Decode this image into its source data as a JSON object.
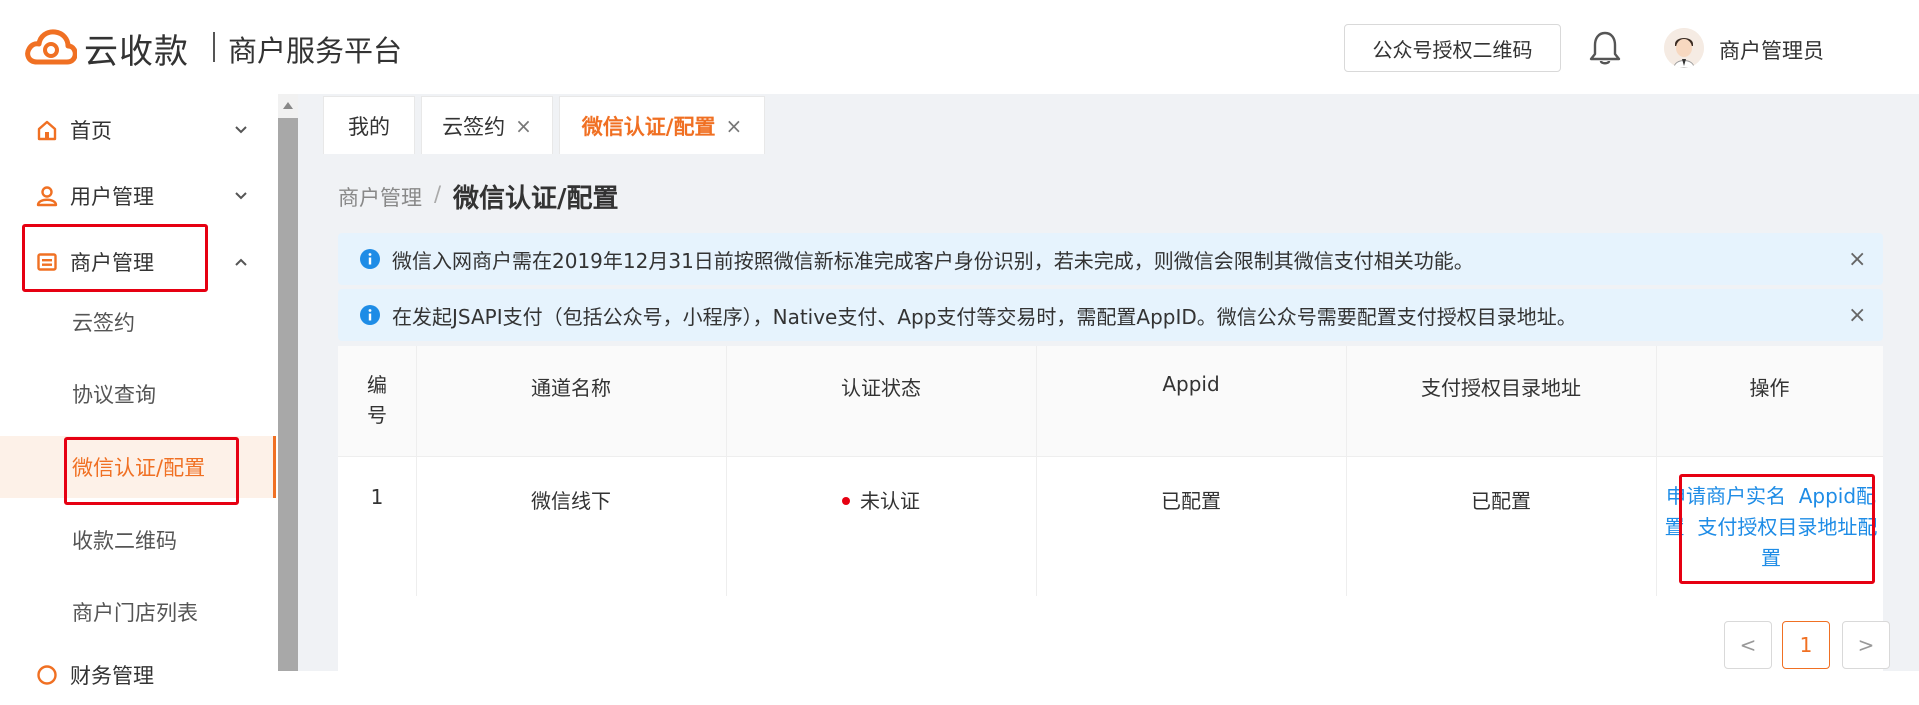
{
  "header": {
    "logo_text": "云收款",
    "platform_name": "商户服务平台",
    "qr_button_label": "公众号授权二维码",
    "username": "商户管理员"
  },
  "sidebar": {
    "menus": [
      {
        "label": "首页",
        "icon": "home-icon",
        "expanded": false
      },
      {
        "label": "用户管理",
        "icon": "user-icon",
        "expanded": false
      },
      {
        "label": "商户管理",
        "icon": "merchant-icon",
        "expanded": true
      },
      {
        "label": "财务管理",
        "icon": "finance-icon",
        "expanded": false
      }
    ],
    "submenu": [
      "云签约",
      "协议查询",
      "微信认证/配置",
      "收款二维码",
      "商户门店列表"
    ],
    "active_submenu": "微信认证/配置"
  },
  "tabs": [
    {
      "label": "我的",
      "closable": false
    },
    {
      "label": "云签约",
      "closable": true
    },
    {
      "label": "微信认证/配置",
      "closable": true,
      "active": true
    }
  ],
  "tab_close_glyph": "×",
  "breadcrumb": {
    "parent": "商户管理",
    "separator": "/",
    "current": "微信认证/配置"
  },
  "alerts": [
    {
      "text": "微信入网商户需在2019年12月31日前按照微信新标准完成客户身份识别，若未完成，则微信会限制其微信支付相关功能。"
    },
    {
      "text": "在发起JSAPI支付（包括公众号，小程序），Native支付、App支付等交易时，需配置AppID。微信公众号需要配置支付授权目录地址。"
    }
  ],
  "alert_close_glyph": "×",
  "table": {
    "columns": [
      "编号",
      "通道名称",
      "认证状态",
      "Appid",
      "支付授权目录地址",
      "操作"
    ],
    "rows": [
      {
        "id": "1",
        "channel": "微信线下",
        "status": "未认证",
        "appid": "已配置",
        "pay_dir": "已配置",
        "actions": [
          "申请商户实名",
          "Appid配置",
          "支付授权目录地址配置"
        ]
      }
    ]
  },
  "pagination": {
    "prev": "<",
    "current": "1",
    "next": ">"
  },
  "colors": {
    "accent": "#f07023",
    "link": "#1e8ce6",
    "highlight_box": "#e60012",
    "alert_bg": "#e6f3fd"
  }
}
